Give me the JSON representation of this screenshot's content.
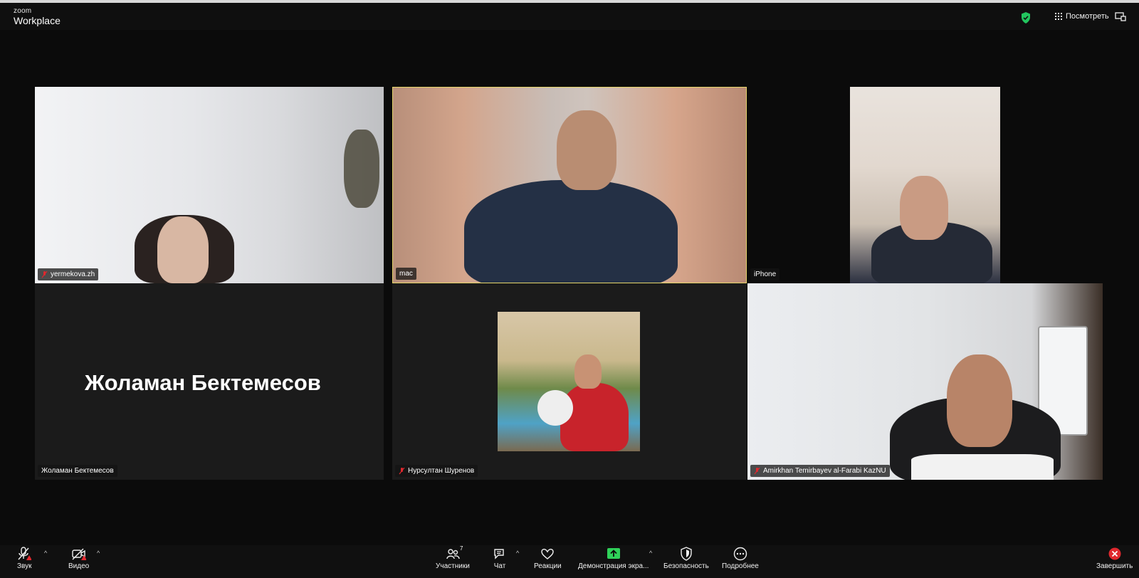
{
  "brand": {
    "top": "zoom",
    "bottom": "Workplace"
  },
  "header": {
    "view_label": "Посмотреть"
  },
  "colors": {
    "accent_green": "#22c55e",
    "active_speaker_border": "#e6d56a",
    "end_red": "#e0282e",
    "share_green": "#2fd159"
  },
  "tiles": [
    {
      "name": "yermekova.zh",
      "muted": true
    },
    {
      "name": "mac",
      "muted": false,
      "active_speaker": true
    },
    {
      "name": "iPhone",
      "muted": false
    },
    {
      "name": "Жоламан Бектемесов",
      "muted": false,
      "big_name": "Жоламан Бектемесов"
    },
    {
      "name": "Нурсултан Шуренов",
      "muted": true
    },
    {
      "name": "Amirkhan Temirbayev al-Farabi KazNU",
      "muted": true
    }
  ],
  "toolbar": {
    "audio": "Звук",
    "video": "Видео",
    "participants": "Участники",
    "participants_count": "7",
    "chat": "Чат",
    "reactions": "Реакции",
    "share": "Демонстрация экра...",
    "security": "Безопасность",
    "more": "Подробнее",
    "end": "Завершить"
  }
}
